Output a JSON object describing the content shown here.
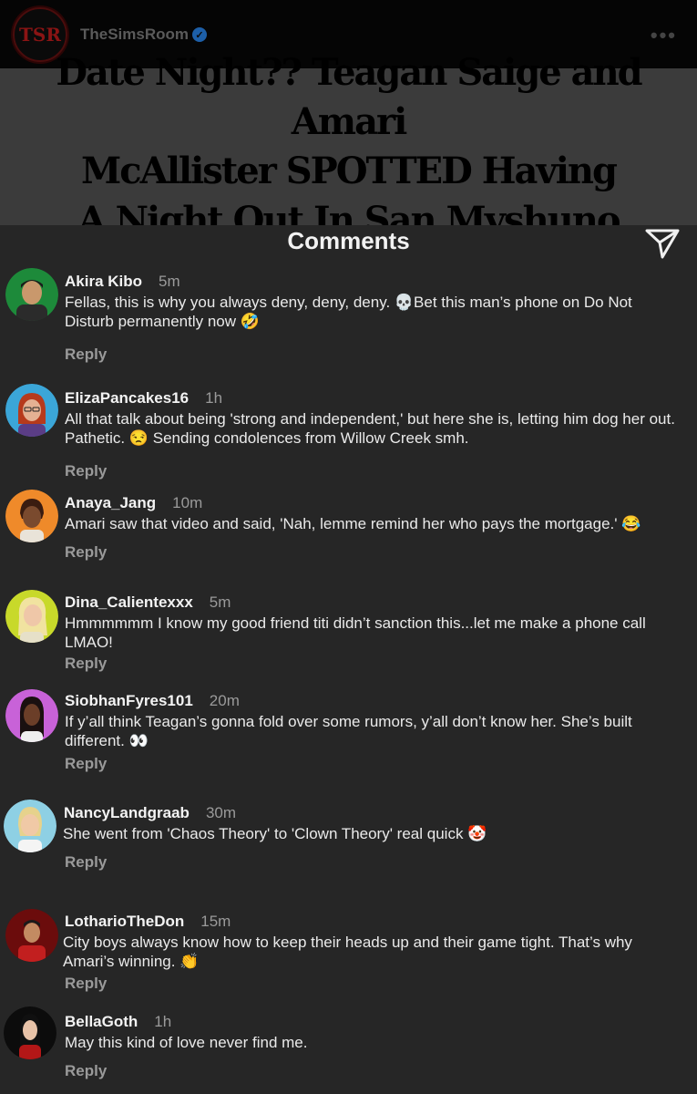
{
  "header": {
    "account_name": "TheSimsRoom",
    "logo_text": "TSR",
    "more_icon": "ellipsis-icon"
  },
  "headline": {
    "lines": [
      "Date Night?? Teagan Saige and Amari",
      "McAllister SPOTTED Having",
      "A Night Out In San Myshuno"
    ]
  },
  "comments_section": {
    "title": "Comments",
    "share_icon": "send-icon",
    "reply_label": "Reply",
    "comments": [
      {
        "user": "Akira Kibo",
        "time": "5m",
        "text": "Fellas, this is why you always deny, deny, deny. 💀Bet this man’s phone on Do Not Disturb permanently now 🤣"
      },
      {
        "user": "ElizaPancakes16",
        "time": "1h",
        "text": "All that talk about being 'strong and independent,' but here she is, letting him dog her out. Pathetic. 😒 Sending condolences from Willow Creek smh."
      },
      {
        "user": "Anaya_Jang",
        "time": "10m",
        "text": "Amari saw that video and said, 'Nah, lemme remind her who pays the mortgage.' 😂"
      },
      {
        "user": "Dina_Calientexxx",
        "time": "5m",
        "text": "Hmmmmmm I know my good friend titi didn’t sanction this...let me make a phone call LMAO!"
      },
      {
        "user": "SiobhanFyres101",
        "time": "20m",
        "text": "If y’all think Teagan’s gonna fold over some rumors, y’all don’t know her. She’s built different. 👀"
      },
      {
        "user": "NancyLandgraab",
        "time": "30m",
        "text": "She went from 'Chaos Theory' to 'Clown Theory' real quick 🤡"
      },
      {
        "user": "LotharioTheDon",
        "time": "15m",
        "text": "City boys always know how to keep their heads up and their game tight. That’s why Amari’s winning. 👏"
      },
      {
        "user": "BellaGoth",
        "time": "1h",
        "text": "May this kind of love never find me."
      }
    ]
  },
  "colors": {
    "background": "#000000",
    "headline_band": "#3b3b3b",
    "comments_bg": "#262626",
    "muted_text": "#9a9a9a",
    "logo_red": "#c0171b"
  }
}
